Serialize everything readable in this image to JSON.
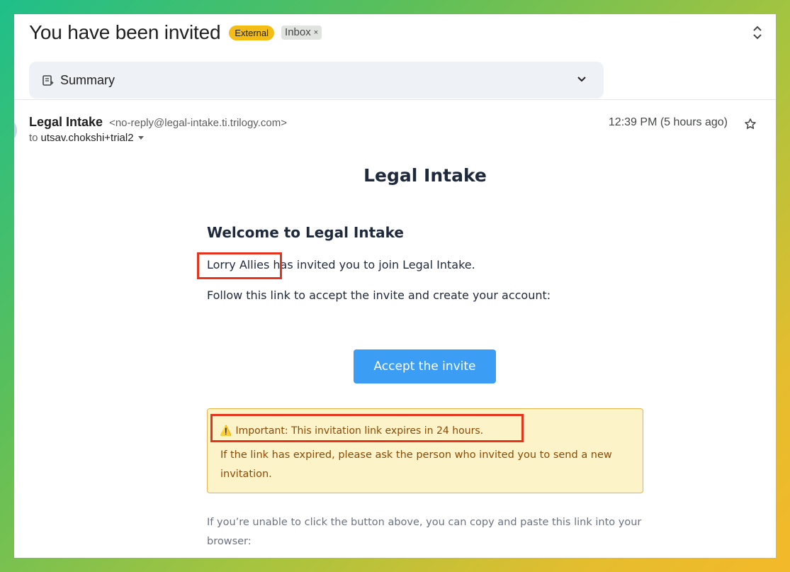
{
  "header": {
    "subject": "You have been invited",
    "label_external": "External",
    "label_inbox": "Inbox",
    "label_inbox_remove": "×"
  },
  "summary": {
    "label": "Summary"
  },
  "message": {
    "sender_name": "Legal Intake",
    "sender_email": "<no-reply@legal-intake.ti.trilogy.com>",
    "to_prefix": "to",
    "recipient": "utsav.chokshi+trial2",
    "time": "12:39 PM (5 hours ago)"
  },
  "email_body": {
    "brand": "Legal Intake",
    "welcome_heading": "Welcome to Legal Intake",
    "inviter_name": "Lorry Allies",
    "invited_text": " has invited you to join Legal Intake.",
    "follow_text": "Follow this link to accept the invite and create your account:",
    "accept_button": "Accept the invite",
    "warning_icon": "⚠️",
    "important_text": "Important: This invitation link expires in 24 hours.",
    "expired_text": "If the link has expired, please ask the person who invited you to send a new invitation.",
    "fallback_text": "If you’re unable to click the button above, you can copy and paste this link into your browser:"
  },
  "icons": {
    "summary": "summary-sparkle-icon",
    "summary_toggle": "chevron-down-icon",
    "nav": "up-down-chevron-icon",
    "star": "star-icon",
    "warning": "warning-icon"
  },
  "colors": {
    "external_chip": "#f4bd16",
    "accept_button": "#3b9df4",
    "notice_bg": "#fdf3c9",
    "notice_text": "#8a4a06",
    "highlight": "#e5341d"
  }
}
